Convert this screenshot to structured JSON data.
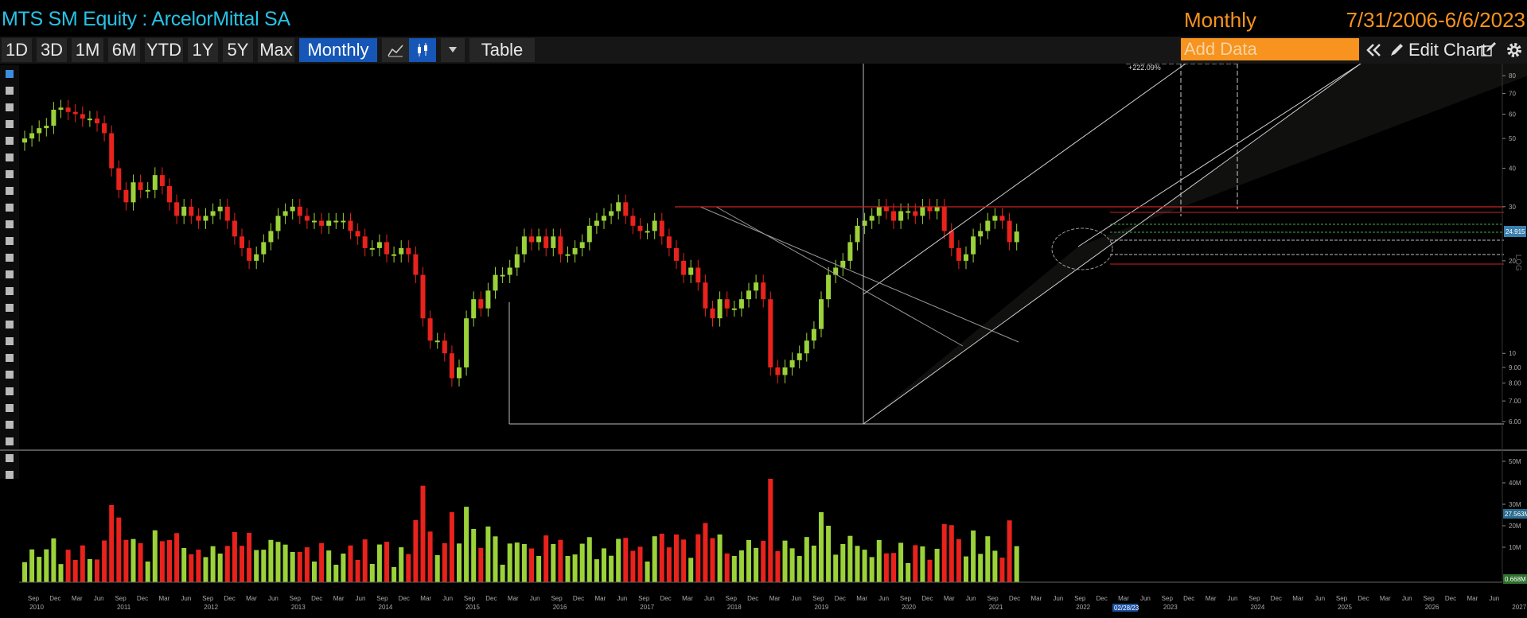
{
  "header": {
    "title": "MTS SM Equity : ArcelorMittal SA",
    "period": "Monthly",
    "date_range": "7/31/2006-6/6/2023"
  },
  "toolbar": {
    "ranges": [
      "1D",
      "3D",
      "1M",
      "6M",
      "YTD",
      "1Y",
      "5Y",
      "Max"
    ],
    "frequency": "Monthly ▼",
    "table": "Table",
    "add_data_placeholder": "Add Data",
    "edit_chart": "Edit Chart"
  },
  "left_tools": [
    "pointer-icon",
    "pencil-icon",
    "crosshair-icon",
    "ruler-icon",
    "trend-line-icon",
    "channel-icon",
    "horizontal-line-icon",
    "brush-icon",
    "arrow-icon",
    "fib-icon",
    "text-r-icon",
    "line-icon",
    "move-icon",
    "select-icon",
    "trash-icon",
    "annotate-icon",
    "rectangle-icon",
    "fill-icon",
    "lines-icon",
    "list-icon",
    "dash-icon",
    "copy-icon",
    "rotate-icon",
    "color-icon",
    "settings-icon"
  ],
  "price_axis": {
    "scale": "log",
    "ticks": [
      "80",
      "70",
      "60",
      "50",
      "40",
      "30",
      "20",
      "10",
      "9.00",
      "8.00",
      "7.00",
      "6.00"
    ],
    "last_price": "24.915",
    "label": "LOG"
  },
  "volume_axis": {
    "ticks": [
      "50M",
      "40M",
      "30M",
      "20M",
      "10M"
    ],
    "last_volume": "27.563M",
    "zero_label": "0.668M"
  },
  "time_axis": {
    "months": [
      "Sep",
      "Dec",
      "Mar",
      "Jun"
    ],
    "years": [
      "2010",
      "2011",
      "2012",
      "2013",
      "2014",
      "2015",
      "2016",
      "2017",
      "2018",
      "2019",
      "2020",
      "2021",
      "2022",
      "2023",
      "2024",
      "2025",
      "2026",
      "2027"
    ],
    "current_label": "02/28/23"
  },
  "annotation": {
    "pct": "+222.09%"
  },
  "colors": {
    "up": "#9bd23a",
    "down": "#e8221c",
    "accent": "#f7931e",
    "title": "#27c3e6",
    "active": "#1656b6"
  },
  "chart_data": {
    "type": "candlestick",
    "frequency": "monthly",
    "start": "2009-08",
    "scale": "log",
    "ylim": [
      6,
      85
    ],
    "closes": [
      50,
      52,
      54,
      55,
      62,
      63,
      61,
      60,
      58,
      58,
      56,
      52,
      40,
      34,
      31,
      36,
      34,
      34,
      38,
      35,
      31,
      28,
      30,
      28,
      27,
      28,
      29,
      30,
      27,
      24,
      22,
      20,
      21,
      23,
      25,
      28,
      29,
      30,
      28,
      27,
      27,
      26,
      27,
      27,
      27,
      25,
      24,
      22,
      22,
      23,
      21,
      21,
      22,
      21,
      18,
      13,
      11,
      11,
      10,
      8.3,
      9,
      13,
      15,
      14,
      16,
      18,
      18,
      19,
      21,
      24,
      23,
      24,
      22,
      24,
      21,
      21,
      22,
      23,
      26,
      27,
      28,
      29,
      31,
      28,
      26,
      25,
      25,
      27,
      24,
      22,
      20,
      18,
      19,
      17,
      14,
      13,
      15,
      14,
      14,
      15,
      16,
      17,
      15,
      9,
      8.5,
      9,
      9.5,
      10,
      11,
      12,
      15,
      18,
      19,
      20,
      23,
      26,
      27,
      28,
      30,
      29,
      27,
      29,
      29,
      28,
      30,
      29,
      30,
      25,
      22,
      20,
      21,
      24,
      25,
      27,
      28,
      27,
      23,
      24.9
    ]
  }
}
